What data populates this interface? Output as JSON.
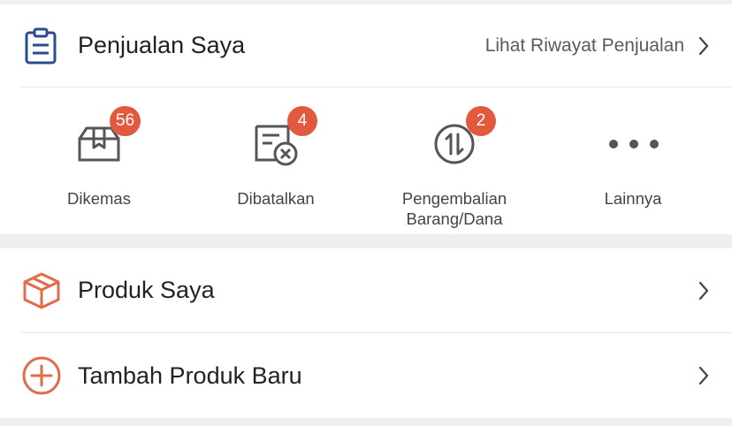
{
  "sales": {
    "title": "Penjualan Saya",
    "history_link": "Lihat Riwayat Penjualan",
    "icon": "clipboard-icon",
    "statuses": [
      {
        "label": "Dikemas",
        "badge": "56",
        "icon": "package-box-icon"
      },
      {
        "label": "Dibatalkan",
        "badge": "4",
        "icon": "cancelled-document-icon"
      },
      {
        "label": "Pengembalian\nBarang/Dana",
        "badge": "2",
        "icon": "return-arrows-icon"
      },
      {
        "label": "Lainnya",
        "badge": null,
        "icon": "more-dots-icon"
      }
    ]
  },
  "products": {
    "my_products": {
      "label": "Produk Saya",
      "icon": "product-cube-icon"
    },
    "add_product": {
      "label": "Tambah Produk Baru",
      "icon": "add-circle-icon"
    }
  },
  "colors": {
    "accent": "#e25a3d",
    "blue_icon": "#2b4c8c",
    "product_icon": "#e36b47",
    "background": "#efefef"
  }
}
